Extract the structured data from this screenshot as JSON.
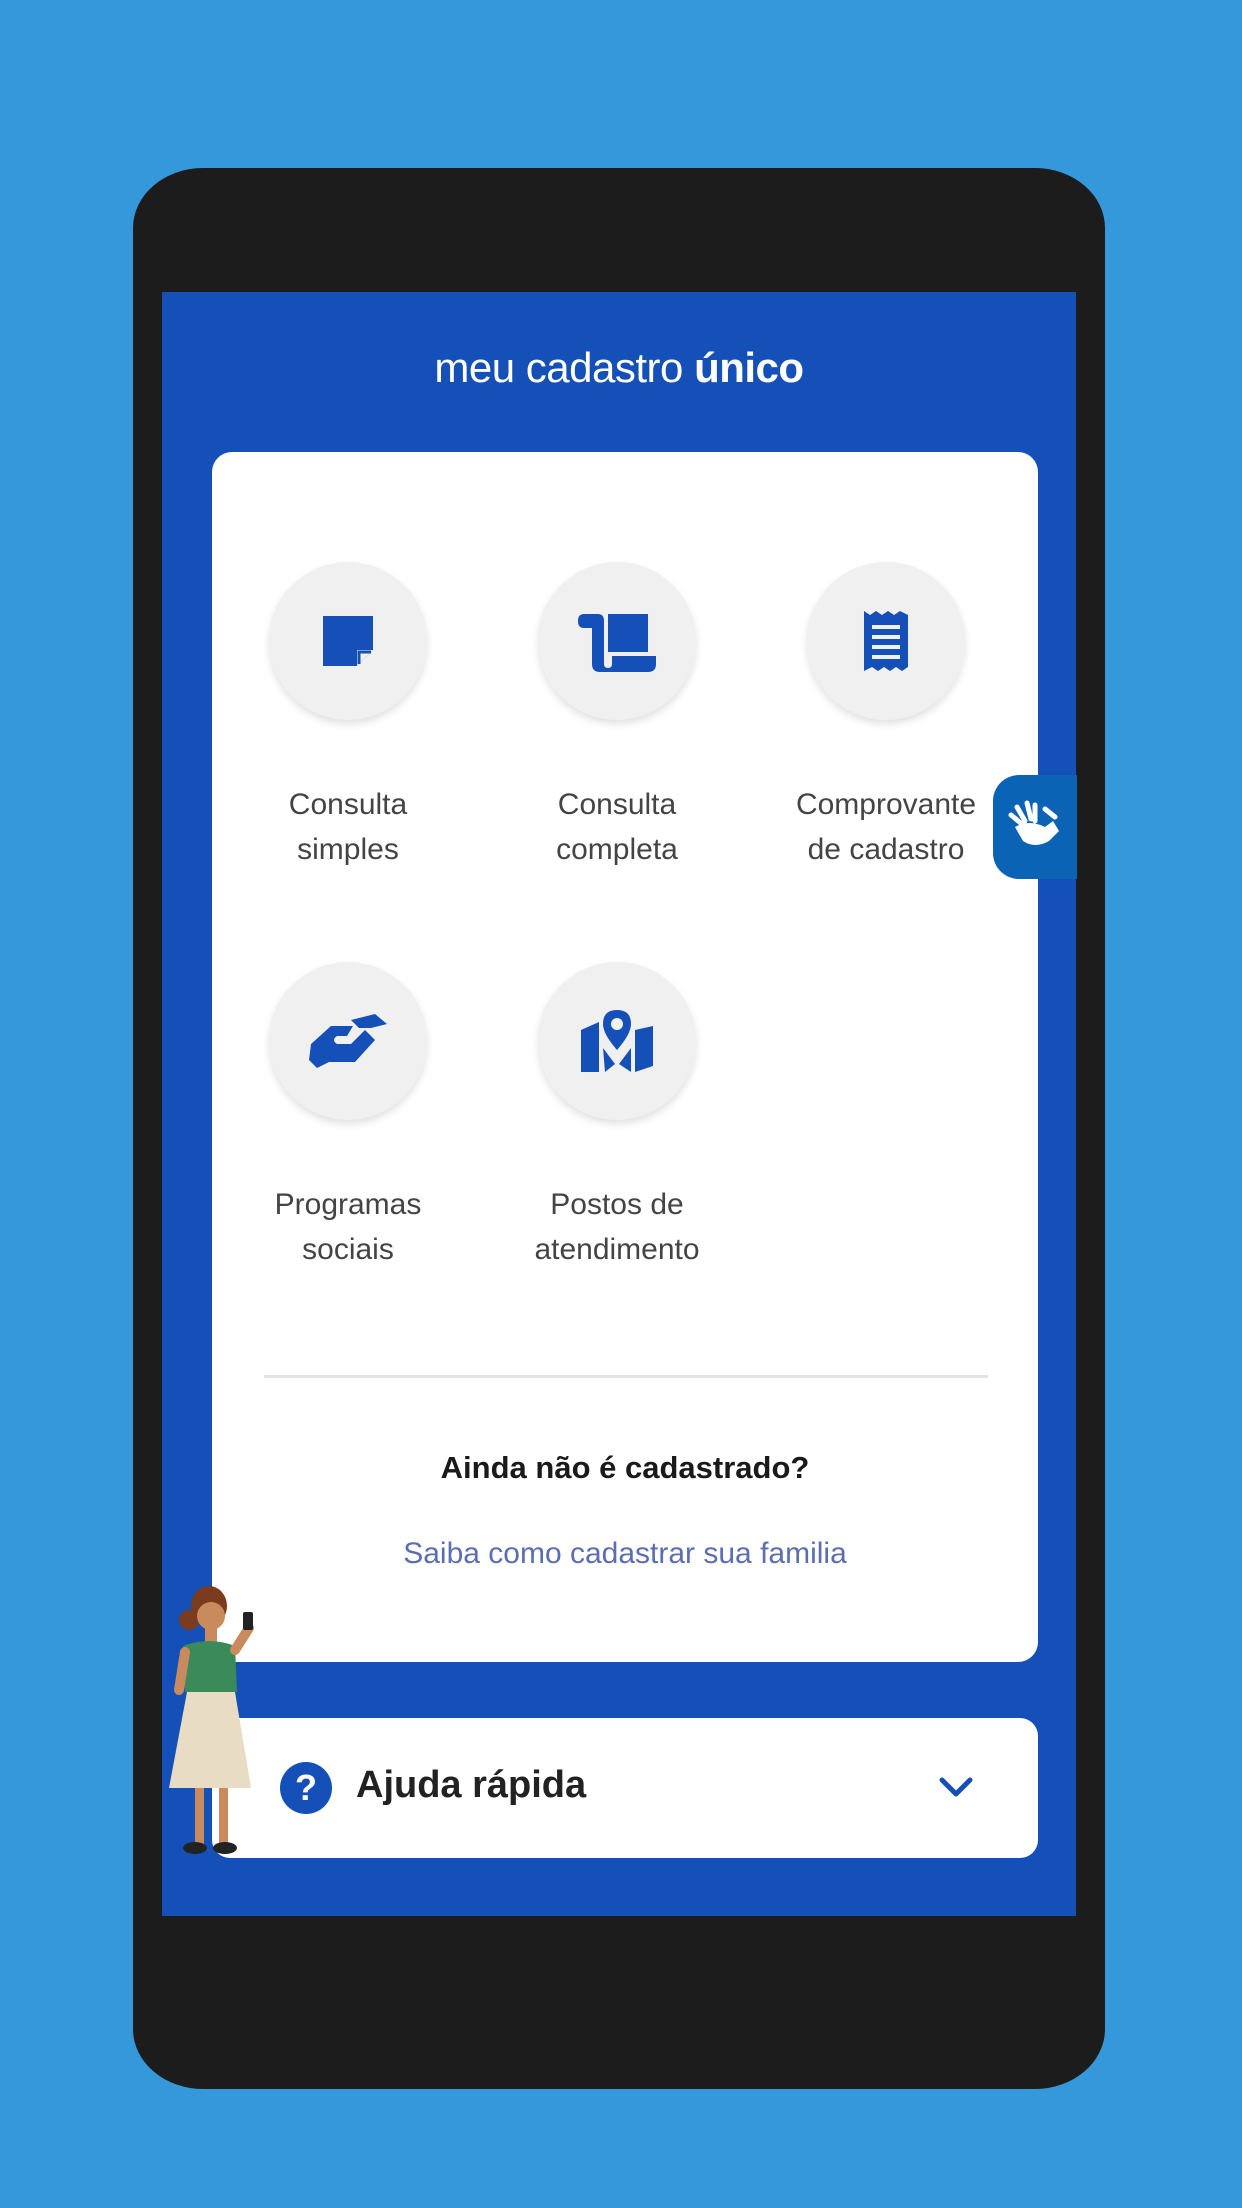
{
  "app": {
    "title_regular": "meu cadastro ",
    "title_bold": "único"
  },
  "menu": [
    {
      "id": "consulta-simples",
      "label_line1": "Consulta",
      "label_line2": "simples",
      "icon": "note-icon"
    },
    {
      "id": "consulta-completa",
      "label_line1": "Consulta",
      "label_line2": "completa",
      "icon": "scroll-icon"
    },
    {
      "id": "comprovante",
      "label_line1": "Comprovante",
      "label_line2": "de cadastro",
      "icon": "receipt-icon"
    },
    {
      "id": "programas-sociais",
      "label_line1": "Programas",
      "label_line2": "sociais",
      "icon": "handshake-icon"
    },
    {
      "id": "postos",
      "label_line1": "Postos de",
      "label_line2": "atendimento",
      "icon": "map-pin-icon"
    }
  ],
  "cta": {
    "title": "Ainda não é cadastrado?",
    "link": "Saiba como cadastrar sua familia"
  },
  "help": {
    "label": "Ajuda rápida"
  },
  "colors": {
    "background": "#3498db",
    "app_blue": "#1450b8",
    "device": "#1c1c1c",
    "vlibras": "#0a63b4"
  }
}
